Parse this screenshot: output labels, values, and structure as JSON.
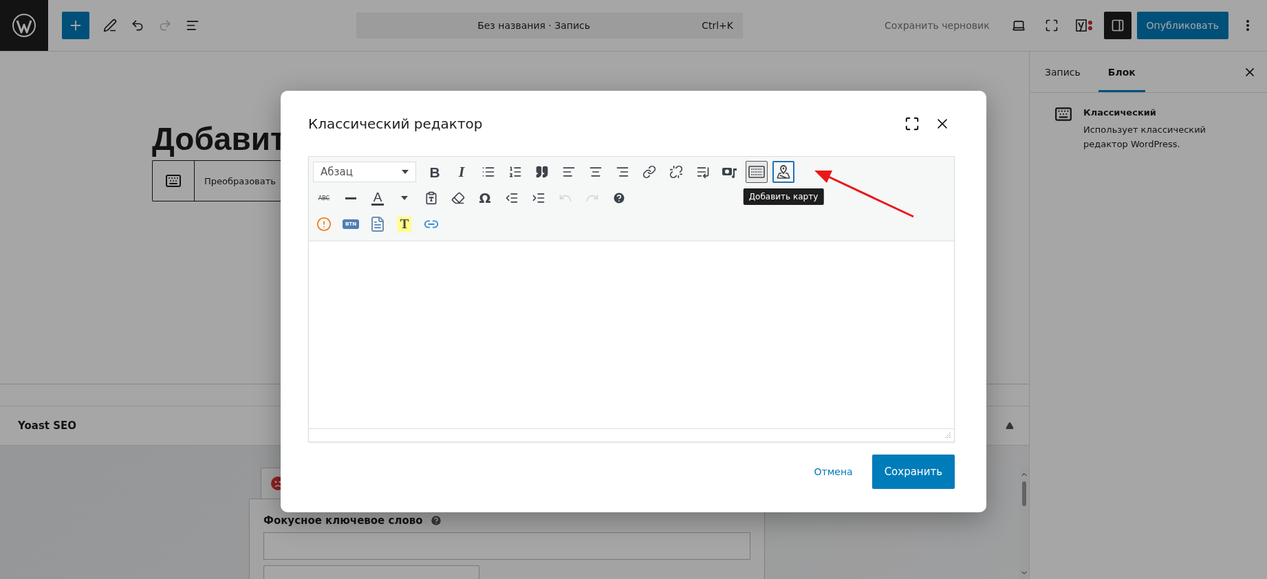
{
  "top_bar": {
    "title": "Без названия · Запись",
    "shortcut": "Ctrl+K",
    "save_draft": "Сохранить черновик",
    "publish": "Опубликовать",
    "redo_disabled": true,
    "sidebar_toggle_on": true
  },
  "editor": {
    "title": "Добавит",
    "block_action": "Преобразовать"
  },
  "yoast": {
    "title": "Yoast SEO",
    "focus_keyword_label": "Фокусное ключевое слово"
  },
  "sidebar": {
    "tabs": [
      {
        "label": "Запись",
        "selected": false
      },
      {
        "label": "Блок",
        "selected": true
      }
    ],
    "block": {
      "name": "Классический",
      "description": "Использует классический редактор WordPress."
    }
  },
  "modal": {
    "title": "Классический редактор",
    "format": "Абзац",
    "tooltip": "Добавить карту",
    "cancel": "Отмена",
    "save": "Сохранить",
    "toolbar_rows": [
      [
        {
          "kind": "bold",
          "glyph": "B",
          "pressed": false,
          "focused": false
        },
        {
          "kind": "italic",
          "glyph": "I",
          "pressed": false,
          "focused": false
        },
        {
          "kind": "bullist",
          "pressed": false,
          "focused": false
        },
        {
          "kind": "numlist",
          "pressed": false,
          "focused": false
        },
        {
          "kind": "blockquote",
          "pressed": false,
          "focused": false
        },
        {
          "kind": "alignleft",
          "pressed": false,
          "focused": false
        },
        {
          "kind": "aligncenter",
          "pressed": false,
          "focused": false
        },
        {
          "kind": "alignright",
          "pressed": false,
          "focused": false
        },
        {
          "kind": "link",
          "pressed": false,
          "focused": false
        },
        {
          "kind": "unlink",
          "pressed": false,
          "focused": false
        },
        {
          "kind": "readmore",
          "pressed": false,
          "focused": false
        },
        {
          "kind": "media",
          "pressed": false,
          "focused": false
        },
        {
          "kind": "kitchensink",
          "pressed": true,
          "focused": false
        },
        {
          "kind": "map",
          "pressed": false,
          "focused": true
        }
      ],
      [
        {
          "kind": "strike",
          "glyph": "ABC",
          "disabled": false
        },
        {
          "kind": "hr",
          "disabled": false
        },
        {
          "kind": "forecolor",
          "glyph": "A",
          "disabled": false
        },
        {
          "kind": "pastetext",
          "disabled": false
        },
        {
          "kind": "eraser",
          "disabled": false
        },
        {
          "kind": "charmap",
          "glyph": "Ω",
          "disabled": false
        },
        {
          "kind": "outdent",
          "disabled": false
        },
        {
          "kind": "indent",
          "disabled": false
        },
        {
          "kind": "undo",
          "disabled": true
        },
        {
          "kind": "redo",
          "disabled": true
        },
        {
          "kind": "help",
          "disabled": false
        }
      ],
      [
        {
          "kind": "alert"
        },
        {
          "kind": "btn",
          "glyph": "BTN"
        },
        {
          "kind": "template"
        },
        {
          "kind": "highlight",
          "glyph": "T"
        },
        {
          "kind": "extlink"
        }
      ]
    ]
  }
}
